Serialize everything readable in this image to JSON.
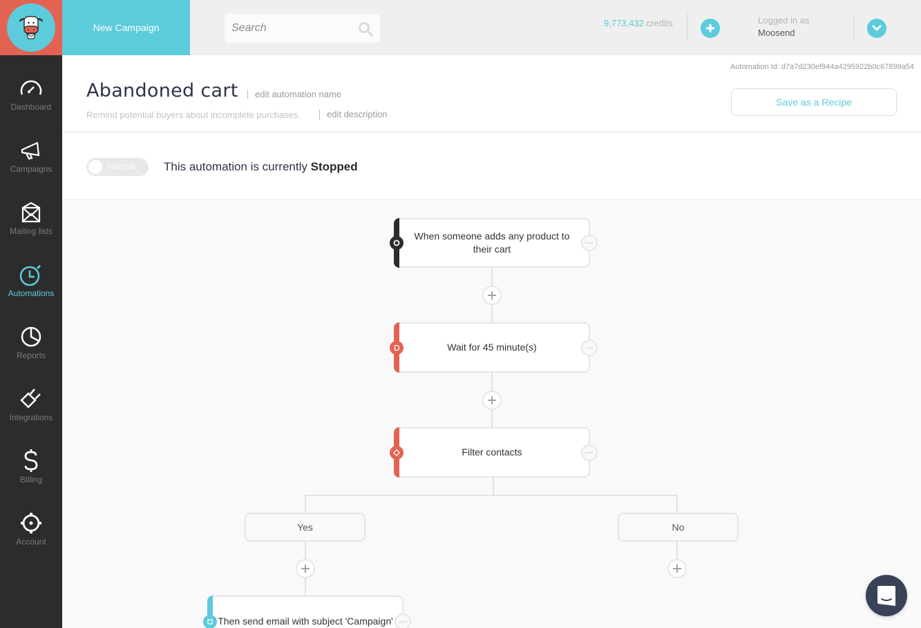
{
  "topbar": {
    "logo": "moosend-cow-logo",
    "new_campaign_label": "New Campaign",
    "search_placeholder": "Search",
    "search_value": "",
    "credits_value": "9,773,432",
    "credits_label": "credits",
    "logged_in_label": "Logged in as",
    "username": "Moosend"
  },
  "sidebar": {
    "items": [
      {
        "label": "Dashboard",
        "icon": "speedometer-icon",
        "active": false
      },
      {
        "label": "Campaigns",
        "icon": "megaphone-icon",
        "active": false
      },
      {
        "label": "Mailing lists",
        "icon": "envelope-icon",
        "active": false
      },
      {
        "label": "Automations",
        "icon": "stopwatch-icon",
        "active": true
      },
      {
        "label": "Reports",
        "icon": "pie-chart-icon",
        "active": false
      },
      {
        "label": "Integrations",
        "icon": "plug-icon",
        "active": false
      },
      {
        "label": "Billing",
        "icon": "dollar-icon",
        "active": false
      },
      {
        "label": "Account",
        "icon": "gear-icon",
        "active": false
      }
    ]
  },
  "header": {
    "automation_id": "Automation Id: d7a7d230ef944a4295922b0c67899a54",
    "title": "Abandoned cart",
    "edit_name_label": "edit automation name",
    "description": "Remind potential buyers about incomplete purchases.",
    "edit_description_label": "edit description",
    "save_recipe_label": "Save as a Recipe"
  },
  "status": {
    "toggle_label": "INACTIVE",
    "toggle_on": false,
    "text_prefix": "This automation is currently",
    "state": "Stopped"
  },
  "workflow": {
    "trigger": {
      "text": "When someone adds any product to their cart",
      "icon": "trigger-circle-icon"
    },
    "wait": {
      "text": "Wait for 45 minute(s)",
      "icon": "delay-icon"
    },
    "filter": {
      "text": "Filter contacts",
      "icon": "diamond-icon"
    },
    "branches": {
      "yes": "Yes",
      "no": "No"
    },
    "action": {
      "text": "Then send email with subject 'Campaign'",
      "icon": "square-icon"
    }
  },
  "colors": {
    "accent": "#5ccbdc",
    "brand_red": "#e36352",
    "sidebar_bg": "#2c2c2c",
    "trigger_bar": "#2c2c2c"
  }
}
